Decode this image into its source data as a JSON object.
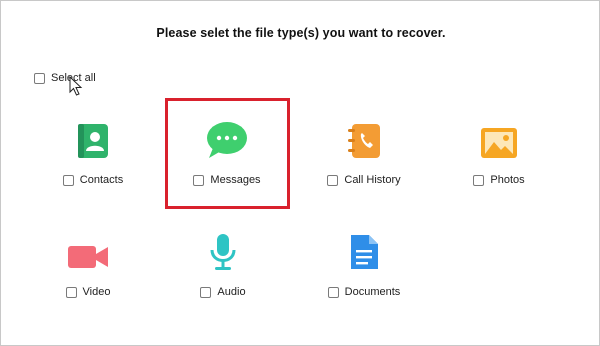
{
  "title": "Please selet the file type(s) you want to recover.",
  "select_all": {
    "label": "Select all",
    "checked": false
  },
  "file_types": [
    {
      "label": "Contacts",
      "icon": "contacts-icon",
      "checked": false
    },
    {
      "label": "Messages",
      "icon": "messages-icon",
      "checked": false,
      "highlighted": true
    },
    {
      "label": "Call History",
      "icon": "call-history-icon",
      "checked": false
    },
    {
      "label": "Photos",
      "icon": "photos-icon",
      "checked": false
    },
    {
      "label": "Video",
      "icon": "video-icon",
      "checked": false
    },
    {
      "label": "Audio",
      "icon": "audio-icon",
      "checked": false
    },
    {
      "label": "Documents",
      "icon": "documents-icon",
      "checked": false
    }
  ],
  "colors": {
    "highlight": "#d9212d",
    "contacts": "#2fb36b",
    "messages": "#3fcf6e",
    "call_history": "#f39c34",
    "photos": "#f6a623",
    "video": "#f36b78",
    "audio": "#2ec4c4",
    "documents": "#2f8ee8"
  }
}
